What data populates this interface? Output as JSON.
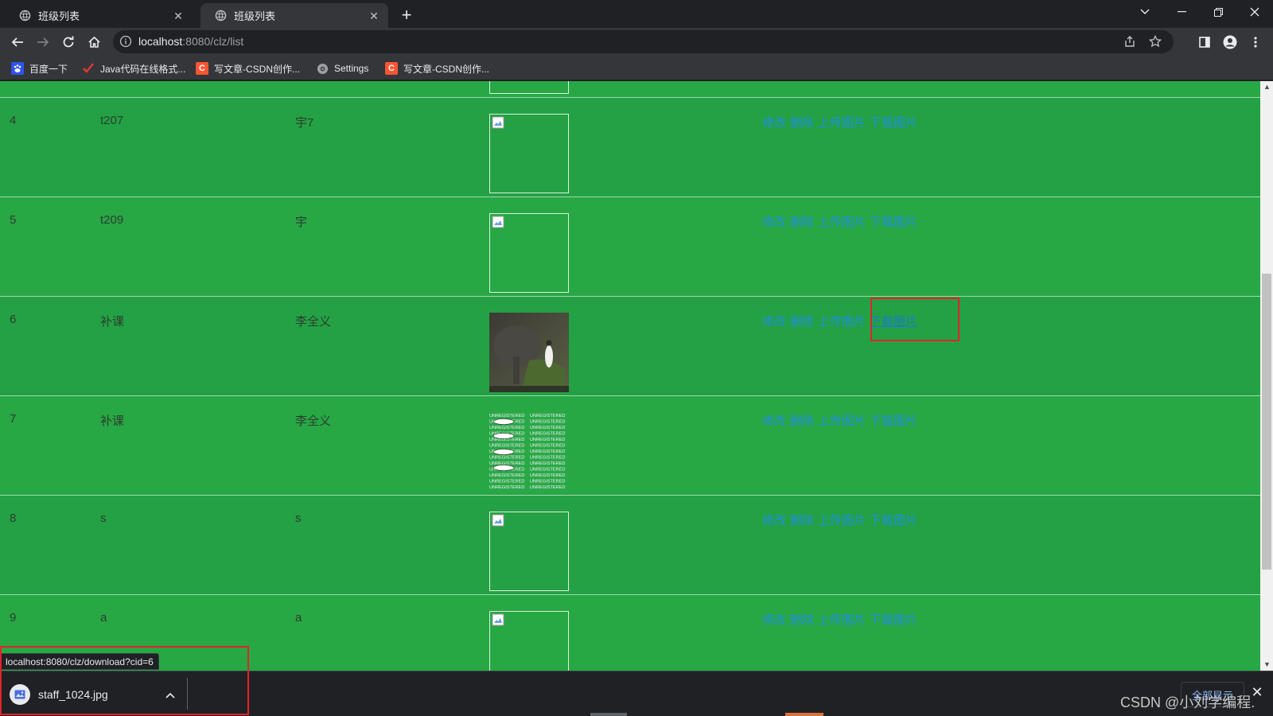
{
  "browser": {
    "tabs": [
      {
        "title": "班级列表",
        "active": false
      },
      {
        "title": "班级列表",
        "active": true
      }
    ],
    "url_host": "localhost",
    "url_rest": ":8080/clz/list",
    "bookmarks": [
      {
        "label": "百度一下",
        "icon": "baidu-icon"
      },
      {
        "label": "Java代码在线格式...",
        "icon": "checkmark-icon"
      },
      {
        "label": "写文章-CSDN创作...",
        "icon": "csdn-icon"
      },
      {
        "label": "Settings",
        "icon": "gear-icon"
      },
      {
        "label": "写文章-CSDN创作...",
        "icon": "csdn-icon"
      }
    ]
  },
  "table": {
    "actions": [
      "修改",
      "删除",
      "上传图片",
      "下载图片"
    ],
    "rows": [
      {
        "id": "",
        "code": "",
        "name": "",
        "image": "broken"
      },
      {
        "id": "4",
        "code": "t207",
        "name": "宇7",
        "image": "broken"
      },
      {
        "id": "5",
        "code": "t209",
        "name": "宇",
        "image": "broken"
      },
      {
        "id": "6",
        "code": "补课",
        "name": "李全义",
        "image": "photo"
      },
      {
        "id": "7",
        "code": "补课",
        "name": "李全义",
        "image": "watermark"
      },
      {
        "id": "8",
        "code": "s",
        "name": "s",
        "image": "broken"
      },
      {
        "id": "9",
        "code": "a",
        "name": "a",
        "image": "broken"
      }
    ],
    "watermark_text": "UNREGISTERED"
  },
  "status": {
    "link_url": "localhost:8080/clz/download?cid=6"
  },
  "download": {
    "file_name": "staff_1024.jpg",
    "show_all": "全部显示"
  },
  "watermark": "CSDN @小刘学编程."
}
